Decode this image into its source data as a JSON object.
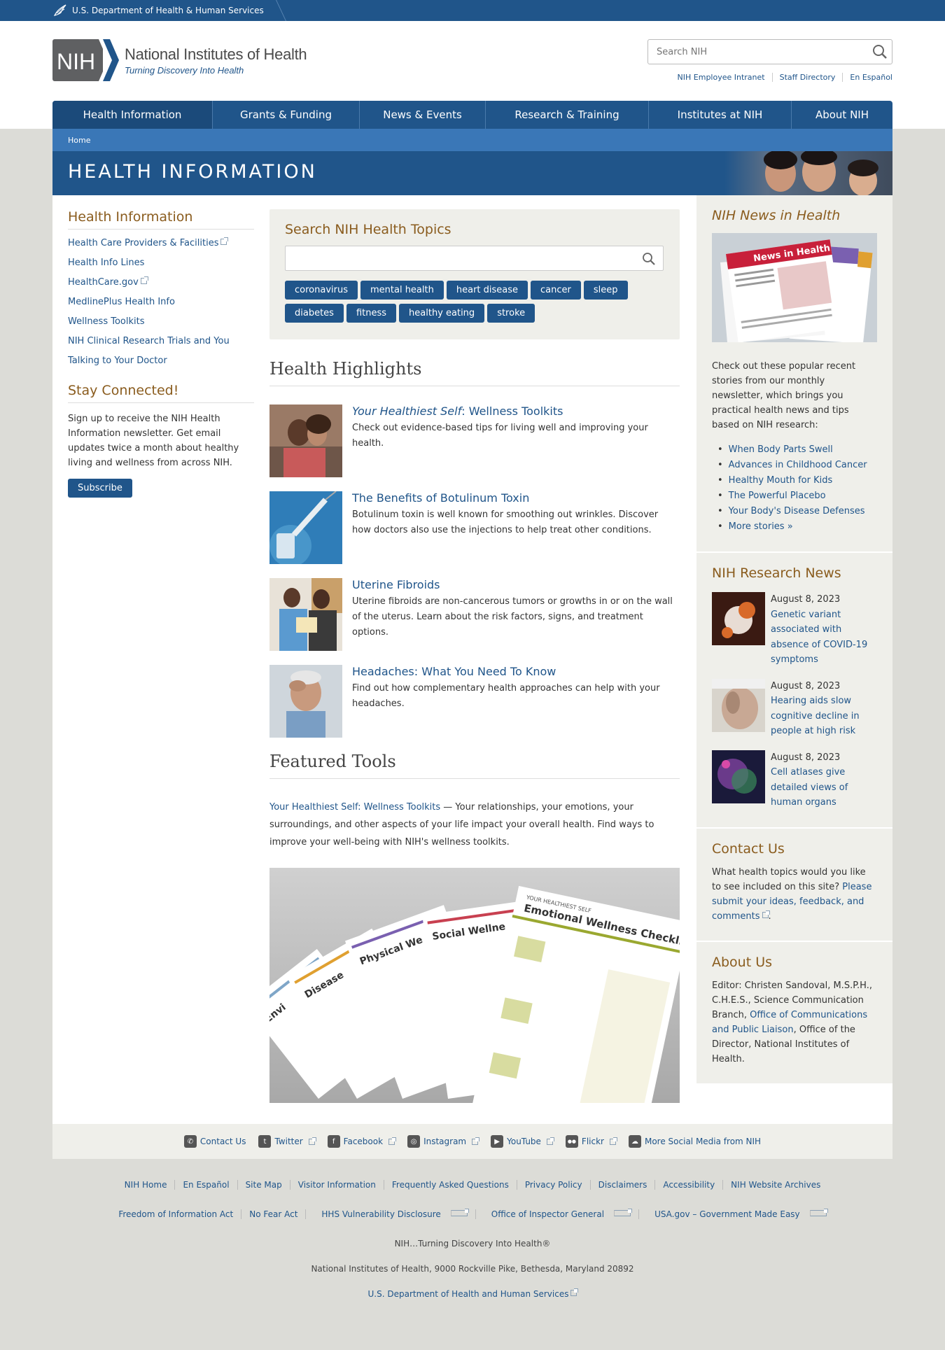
{
  "hhs_bar": {
    "label": "U.S. Department of Health & Human Services"
  },
  "header": {
    "logo_abbr": "NIH",
    "logo_title": "National Institutes of Health",
    "logo_tagline": "Turning Discovery Into Health",
    "search_placeholder": "Search NIH",
    "util_links": [
      "NIH Employee Intranet",
      "Staff Directory",
      "En Español"
    ]
  },
  "nav": [
    "Health Information",
    "Grants & Funding",
    "News & Events",
    "Research & Training",
    "Institutes at NIH",
    "About NIH"
  ],
  "breadcrumb": "Home",
  "banner_title": "HEALTH INFORMATION",
  "left": {
    "heading": "Health Information",
    "links": [
      {
        "label": "Health Care Providers & Facilities",
        "ext": true
      },
      {
        "label": "Health Info Lines",
        "ext": false
      },
      {
        "label": "HealthCare.gov",
        "ext": true
      },
      {
        "label": "MedlinePlus Health Info",
        "ext": false
      },
      {
        "label": "Wellness Toolkits",
        "ext": false
      },
      {
        "label": "NIH Clinical Research Trials and You",
        "ext": false
      },
      {
        "label": "Talking to Your Doctor",
        "ext": false
      }
    ],
    "stay_heading": "Stay Connected!",
    "stay_text": "Sign up to receive the NIH Health Information newsletter. Get email updates twice a month about healthy living and wellness from across NIH.",
    "subscribe": "Subscribe"
  },
  "topics": {
    "title": "Search NIH Health Topics",
    "tags": [
      "coronavirus",
      "mental health",
      "heart disease",
      "cancer",
      "sleep",
      "diabetes",
      "fitness",
      "healthy eating",
      "stroke"
    ]
  },
  "highlights": {
    "heading": "Health Highlights",
    "items": [
      {
        "title_it": "Your Healthiest Self",
        "title": ": Wellness Toolkits",
        "desc": "Check out evidence-based tips for living well and improving your health."
      },
      {
        "title_it": "",
        "title": "The Benefits of Botulinum Toxin",
        "desc": "Botulinum toxin is well known for smoothing out wrinkles. Discover how doctors also use the injections to help treat other conditions."
      },
      {
        "title_it": "",
        "title": "Uterine Fibroids",
        "desc": "Uterine fibroids are non-cancerous tumors or growths in or on the wall of the uterus. Learn about the risk factors, signs, and treatment options."
      },
      {
        "title_it": "",
        "title": "Headaches: What You Need To Know",
        "desc": "Find out how complementary health approaches can help with your headaches."
      }
    ]
  },
  "featured": {
    "heading": "Featured Tools",
    "link": "Your Healthiest Self: Wellness Toolkits",
    "text": " — Your relationships, your emotions, your surroundings, and other aspects of your life impact your overall health. Find ways to improve your well-being with NIH's wellness toolkits.",
    "img_labels": [
      "YOUR HEALTHIEST SELF",
      "Emotional Wellness Checklist",
      "Social Wellne",
      "Physical We",
      "Disease",
      "Envi"
    ]
  },
  "right": {
    "news_heading": "NIH News in Health",
    "news_img_label": "News in Health",
    "news_text": "Check out these popular recent stories from our monthly newsletter, which brings you practical health news and tips based on NIH research:",
    "news_links": [
      "When Body Parts Swell",
      "Advances in Childhood Cancer",
      "Healthy Mouth for Kids",
      "The Powerful Placebo",
      "Your Body's Disease Defenses",
      "More stories »"
    ],
    "research_heading": "NIH Research News",
    "research_items": [
      {
        "date": "August 8, 2023",
        "title": "Genetic variant associated with absence of COVID-19 symptoms"
      },
      {
        "date": "August 8, 2023",
        "title": "Hearing aids slow cognitive decline in people at high risk"
      },
      {
        "date": "August 8, 2023",
        "title": "Cell atlases give detailed views of human organs"
      }
    ],
    "contact_heading": "Contact Us",
    "contact_text": "What health topics would you like to see included on this site? ",
    "contact_link": "Please submit your ideas, feedback, and comments",
    "contact_end": ".",
    "about_heading": "About Us",
    "about_text1": "Editor: Christen Sandoval, M.S.P.H., C.H.E.S., Science Communication Branch, ",
    "about_link": "Office of Communications and Public Liaison",
    "about_text2": ", Office of the Director, National Institutes of Health."
  },
  "social": [
    {
      "label": "Contact Us",
      "icon": "phone-icon",
      "glyph": "✆",
      "ext": false
    },
    {
      "label": "Twitter",
      "icon": "twitter-icon",
      "glyph": "t",
      "ext": true
    },
    {
      "label": "Facebook",
      "icon": "facebook-icon",
      "glyph": "f",
      "ext": true
    },
    {
      "label": "Instagram",
      "icon": "instagram-icon",
      "glyph": "◎",
      "ext": true
    },
    {
      "label": "YouTube",
      "icon": "youtube-icon",
      "glyph": "▶",
      "ext": true
    },
    {
      "label": "Flickr",
      "icon": "flickr-icon",
      "glyph": "●●",
      "ext": true
    },
    {
      "label": "More Social Media from NIH",
      "icon": "social-media-icon",
      "glyph": "☁",
      "ext": false
    }
  ],
  "footer": {
    "row1": [
      "NIH Home",
      "En Español",
      "Site Map",
      "Visitor Information",
      "Frequently Asked Questions",
      "Privacy Policy",
      "Disclaimers",
      "Accessibility",
      "NIH Website Archives"
    ],
    "row2": [
      {
        "label": "Freedom of Information Act",
        "ext": false
      },
      {
        "label": "No Fear Act",
        "ext": false
      },
      {
        "label": "HHS Vulnerability Disclosure",
        "ext": true
      },
      {
        "label": "Office of Inspector General",
        "ext": true
      },
      {
        "label": "USA.gov – Government Made Easy",
        "ext": true
      }
    ],
    "tagline": "NIH…Turning Discovery Into Health®",
    "address": "National Institutes of Health, 9000 Rockville Pike, Bethesda, Maryland 20892",
    "hhs_link": "U.S. Department of Health and Human Services"
  },
  "colors": {
    "nih_blue": "#20558a",
    "crumb_blue": "#3a77b7",
    "heading_brown": "#8a5c1e",
    "panel_gray": "#efefea",
    "page_bg": "#dcdcd7"
  }
}
